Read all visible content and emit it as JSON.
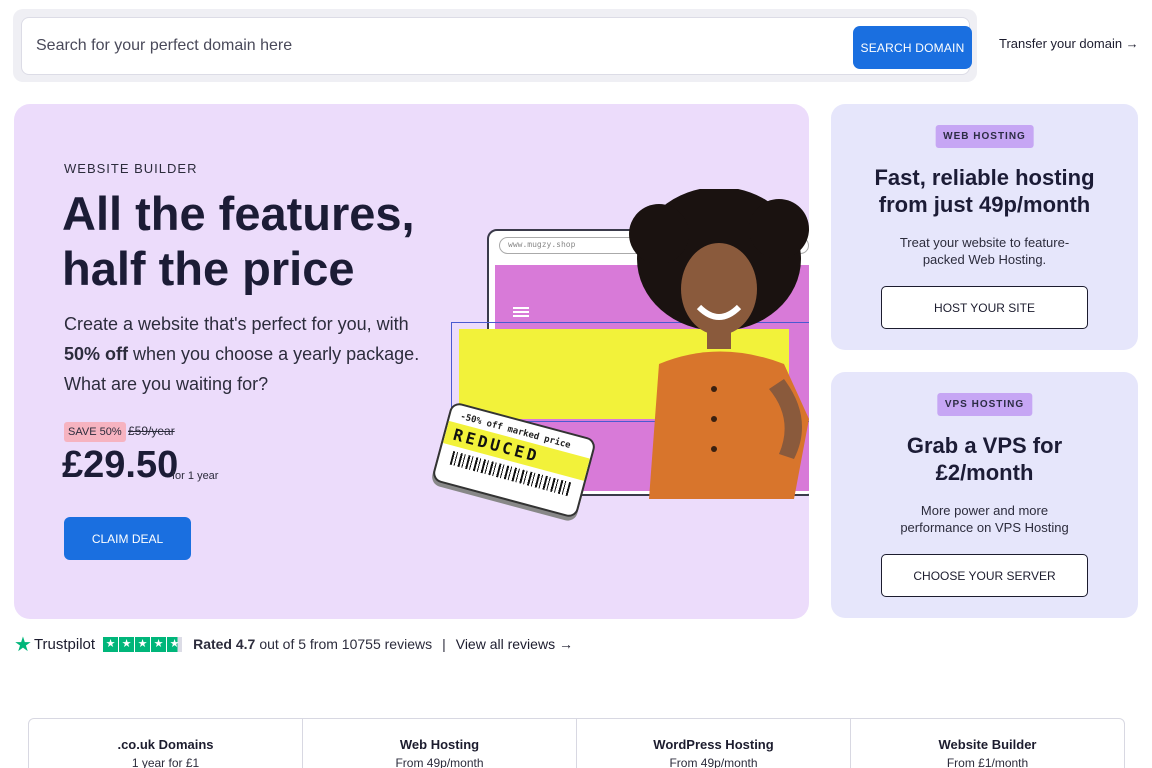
{
  "search": {
    "placeholder": "Search for your perfect domain here",
    "button_label": "SEARCH DOMAIN",
    "transfer_label": "Transfer your domain →"
  },
  "hero": {
    "eyebrow": "WEBSITE BUILDER",
    "title": "All the features, half the price",
    "desc_before": "Create a website that's perfect for you, with ",
    "desc_bold": "50% off",
    "desc_after": " when you choose a yearly package. What are you waiting for?",
    "save_badge": "SAVE 50%",
    "old_price": "£59/year",
    "price": "£29.50",
    "price_term": "for 1 year",
    "cta_label": "CLAIM DEAL",
    "illustration": {
      "url": "www.mugzy.shop",
      "sticker_top": "-50% off marked price",
      "sticker_main": "REDUCED"
    }
  },
  "web_hosting_card": {
    "tag": "WEB HOSTING",
    "title": "Fast, reliable hosting from just 49p/month",
    "desc": "Treat your website to feature-packed Web Hosting.",
    "button_label": "HOST YOUR SITE"
  },
  "vps_card": {
    "tag": "VPS HOSTING",
    "title": "Grab a VPS for £2/month",
    "desc": "More power and more performance on VPS Hosting",
    "button_label": "CHOOSE YOUR SERVER"
  },
  "trustpilot": {
    "brand": "Trustpilot",
    "rated_label": "Rated 4.7",
    "rating_rest": "out of 5 from 10755 reviews",
    "separator": "|",
    "link_label": "View all reviews →",
    "rating": 4.7,
    "star_color": "#00b67a"
  },
  "bottom_tabs": [
    {
      "title": ".co.uk Domains",
      "sub": "1 year for £1"
    },
    {
      "title": "Web Hosting",
      "sub": "From 49p/month"
    },
    {
      "title": "WordPress Hosting",
      "sub": "From 49p/month"
    },
    {
      "title": "Website Builder",
      "sub": "From £1/month"
    }
  ],
  "colors": {
    "accent": "#1a6fe0",
    "hero_bg": "#ecdcfb",
    "card_bg": "#e6e6fb",
    "tag_bg": "#c6a6f4",
    "save_badge_bg": "#f6b3c0"
  }
}
